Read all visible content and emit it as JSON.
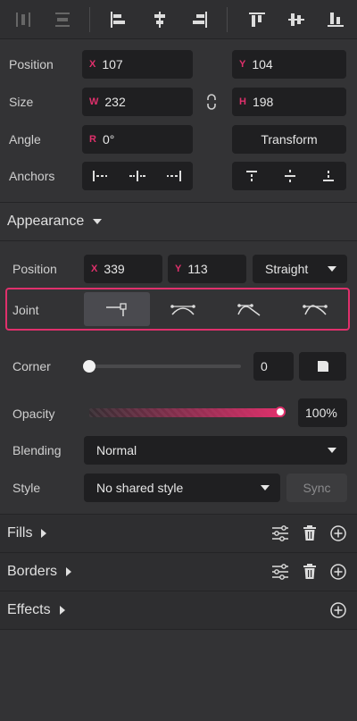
{
  "toolbar": {
    "buttons": [
      "distribute-horizontal-icon",
      "distribute-vertical-icon",
      "align-left-icon",
      "align-center-horizontal-icon",
      "align-right-icon",
      "align-top-icon",
      "align-middle-vertical-icon",
      "align-bottom-icon"
    ]
  },
  "geometry": {
    "position_label": "Position",
    "x_prefix": "X",
    "x_value": "107",
    "y_prefix": "Y",
    "y_value": "104",
    "size_label": "Size",
    "w_prefix": "W",
    "w_value": "232",
    "h_prefix": "H",
    "h_value": "198",
    "angle_label": "Angle",
    "r_prefix": "R",
    "r_value": "0°",
    "transform_label": "Transform",
    "anchors_label": "Anchors"
  },
  "appearance": {
    "title": "Appearance",
    "position_label": "Position",
    "x_prefix": "X",
    "x_value": "339",
    "y_prefix": "Y",
    "y_value": "113",
    "curve_type": "Straight",
    "joint_label": "Joint",
    "joint_options": [
      "straight-joint-icon",
      "mirrored-joint-icon",
      "disconnected-joint-icon",
      "asymmetric-joint-icon"
    ],
    "joint_selected_index": 0,
    "corner_label": "Corner",
    "corner_value": "0",
    "corner_fraction": 0,
    "opacity_label": "Opacity",
    "opacity_value": "100%",
    "opacity_fraction": 1.0,
    "blending_label": "Blending",
    "blending_value": "Normal",
    "style_label": "Style",
    "style_value": "No shared style",
    "sync_label": "Sync"
  },
  "sections": {
    "fills": "Fills",
    "borders": "Borders",
    "effects": "Effects"
  },
  "colors": {
    "accent": "#e0306c",
    "panel_bg": "#333335",
    "field_bg": "#1f1f21"
  }
}
